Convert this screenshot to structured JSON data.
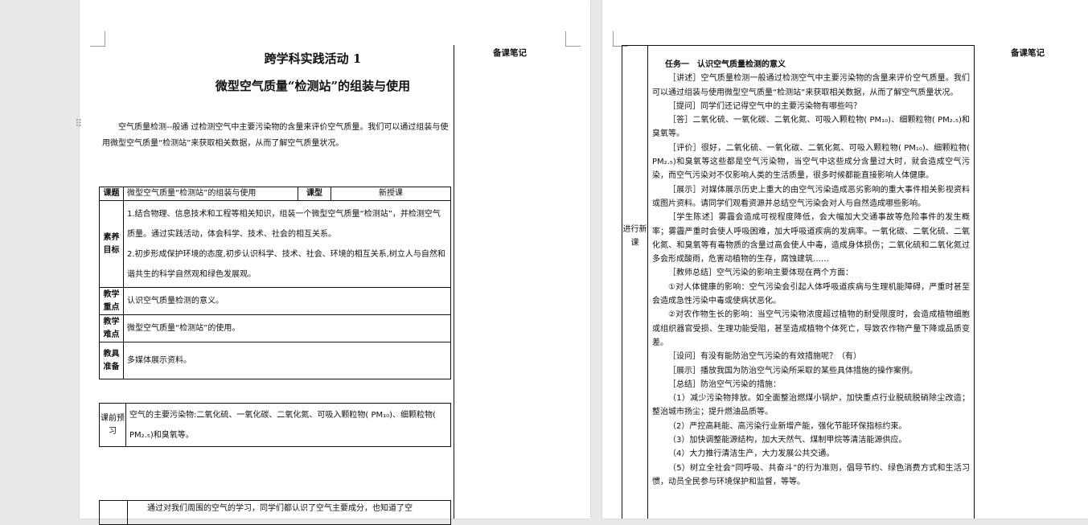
{
  "page1": {
    "title": "跨学科实践活动 1",
    "subtitle": "微型空气质量“检测站”的组装与使用",
    "notes_label": "备课笔记",
    "intro": "空气质量检测--般通 过检测空气中主要污染物的含量来评价空气质量。我们可以通过组装与使用微型空气质量“检测站”来获取相关数据，从而了解空气质量状况。",
    "lesson_table": {
      "topic_label": "课题",
      "topic_value": "微型空气质量“检测站”的组装与使用",
      "type_label": "课型",
      "type_value": "新授课",
      "goals_label": "素养目标",
      "goal1": "1.结合物理、信息技术和工程等相关知识，组装一个微型空气质量“检测站”，并检测空气质量。通过实践活动，体会科学、技术、社会的相互关系。",
      "goal2": "2.初步形成保护环境的态度,初步认识科学、技术、社会、环境的相互关系,树立人与自然和谐共生的科学自然观和绿色发展观。",
      "key_label": "教学重点",
      "key_value": "认识空气质量检测的意义。",
      "difficult_label": "教学难点",
      "difficult_value": "微型空气质量“检测站”的使用。",
      "tools_label": "教具准备",
      "tools_value": "多媒体展示资料。"
    },
    "preview_table": {
      "label": "课前预习",
      "value": "空气的主要污染物:二氧化硫、一氧化碳、二氧化氮、可吸入颗粒物( PM₁₀)、细颗粒物( PM₂.₅)和臭氧等。"
    },
    "bottom_text": "通过对我们周围的空气的学习，同学们都认识了空气主要成分，也知道了空"
  },
  "page2": {
    "notes_label": "备课笔记",
    "side_label": "进行新课",
    "paragraphs": [
      "任务一　认识空气质量检测的意义",
      "［讲述］空气质量检测一般通过检测空气中主要污染物的含量来评价空气质量。我们可以通过组装与使用微型空气质量“检测站”来获取相关数据，从而了解空气质量状况。",
      "［提问］同学们还记得空气中的主要污染物有哪些吗？",
      "［答］二氧化硫、一氧化碳、二氧化氮、可吸入颗粒物( PM₁₀)、细颗粒物( PM₂.₅)和臭氧等。",
      "［评价］很好，二氧化硫、一氧化碳、二氧化氮、可吸入颗粒物( PM₁₀)、细颗粒物( PM₂.₅)和臭氧等这些都是空气污染物，当空气中这些成分含量过大时，就会造成空气污染，而空气污染对不仅影响人类的生活质量，很多时候都能直接影响人体健康。",
      "［展示］对媒体展示历史上重大的由空气污染造成恶劣影响的重大事件相关影视资料或图片资料。请同学们观看资源并总结空气污染会对人与自然造成哪些影响。",
      "［学生陈述］雾霾会造成可视程度降低，会大幅加大交通事故等危险事件的发生概率；雾霾严重时会使人呼吸困难，加大呼吸道疾病的发病率。一氧化碳、二氧化硫、二氧化氮、和臭氧等有毒物质的含量过高会使人中毒，造成身体损伤；二氧化硫和二氧化氮过多会形成酸雨，危害动植物的生存，腐蚀建筑……",
      "［教师总结］空气污染的影响主要体现在两个方面：",
      "①对人体健康的影响：空气污染会引起人体呼吸道疾病与生理机能障碍，严重时甚至会造成急性污染中毒或使病状恶化。",
      "②对农作物生长的影响：当空气污染物浓度超过植物的耐受限度时，会造成植物细胞或组织器官受损、生理功能受阻，甚至造成植物个体死亡，导致农作物产量下降或品质变差。",
      "［设问］有没有能防治空气污染的有效措施呢？（有）",
      "［展示］播放我国为防治空气污染所采取的某些具体措施的操作案例。",
      "［总结］防治空气污染的措施：",
      "（1）减少污染物排放。如全面整治燃煤小锅炉，加快重点行业脱硫脱硝除尘改造；整治城市扬尘；提升燃油品质等。",
      "（2）严控高耗能、高污染行业新增产能，强化节能环保指标约束。",
      "（3）加快调整能源结构，加大天然气、煤制甲烷等清洁能源供应。",
      "（4）大力推行清洁生产，大力发展公共交通。",
      "（5）树立全社会“同呼吸、共奋斗”的行为准则，倡导节约、绿色消费方式和生活习惯，动员全民参与环境保护和监督，等等。"
    ]
  }
}
